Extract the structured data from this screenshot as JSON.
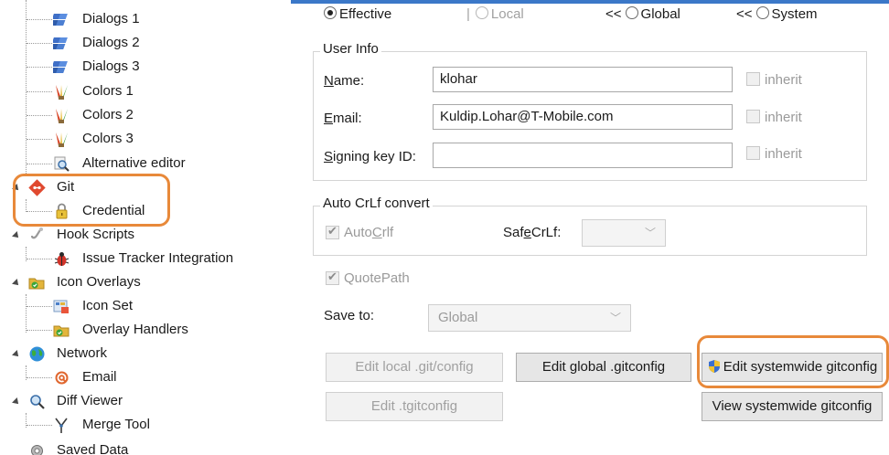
{
  "tree": {
    "items": [
      {
        "label": "Dialogs 1",
        "icon": "dialogs-icon"
      },
      {
        "label": "Dialogs 2",
        "icon": "dialogs-icon"
      },
      {
        "label": "Dialogs 3",
        "icon": "dialogs-icon"
      },
      {
        "label": "Colors 1",
        "icon": "colors-icon"
      },
      {
        "label": "Colors 2",
        "icon": "colors-icon"
      },
      {
        "label": "Colors 3",
        "icon": "colors-icon"
      },
      {
        "label": "Alternative editor",
        "icon": "magnifier-icon"
      },
      {
        "label": "Git",
        "icon": "git-icon"
      },
      {
        "label": "Credential",
        "icon": "lock-icon"
      },
      {
        "label": "Hook Scripts",
        "icon": "hook-icon"
      },
      {
        "label": "Issue Tracker Integration",
        "icon": "bug-icon"
      },
      {
        "label": "Icon Overlays",
        "icon": "overlay-icon"
      },
      {
        "label": "Icon Set",
        "icon": "icon-set-icon"
      },
      {
        "label": "Overlay Handlers",
        "icon": "overlay-icon"
      },
      {
        "label": "Network",
        "icon": "globe-icon"
      },
      {
        "label": "Email",
        "icon": "email-icon"
      },
      {
        "label": "Diff Viewer",
        "icon": "magnifier-icon"
      },
      {
        "label": "Merge Tool",
        "icon": "merge-icon"
      },
      {
        "label": "Saved Data",
        "icon": "gear-icon"
      }
    ]
  },
  "scope": {
    "effective": "Effective",
    "local": "Local",
    "sep1": "<<",
    "global": "Global",
    "sep2": "<<",
    "system": "System"
  },
  "user_info": {
    "title": "User Info",
    "name_label": "Name:",
    "name_value": "klohar",
    "email_label": "Email:",
    "email_value": "Kuldip.Lohar@T-Mobile.com",
    "signing_label": "Signing key ID:",
    "signing_value": "",
    "inherit": "inherit"
  },
  "crlf": {
    "title": "Auto CrLf convert",
    "autocrlf": "AutoCrlf",
    "safecrlf_label": "SafeCrLf:"
  },
  "quotepath": "QuotePath",
  "save_to": {
    "label": "Save to:",
    "value": "Global"
  },
  "buttons": {
    "edit_local": "Edit local .git/config",
    "edit_global": "Edit global .gitconfig",
    "edit_system": "Edit systemwide gitconfig",
    "edit_tgit": "Edit .tgitconfig",
    "view_system": "View systemwide gitconfig"
  },
  "colors": {
    "highlight": "#e8893a",
    "accent": "#3b78c8"
  }
}
